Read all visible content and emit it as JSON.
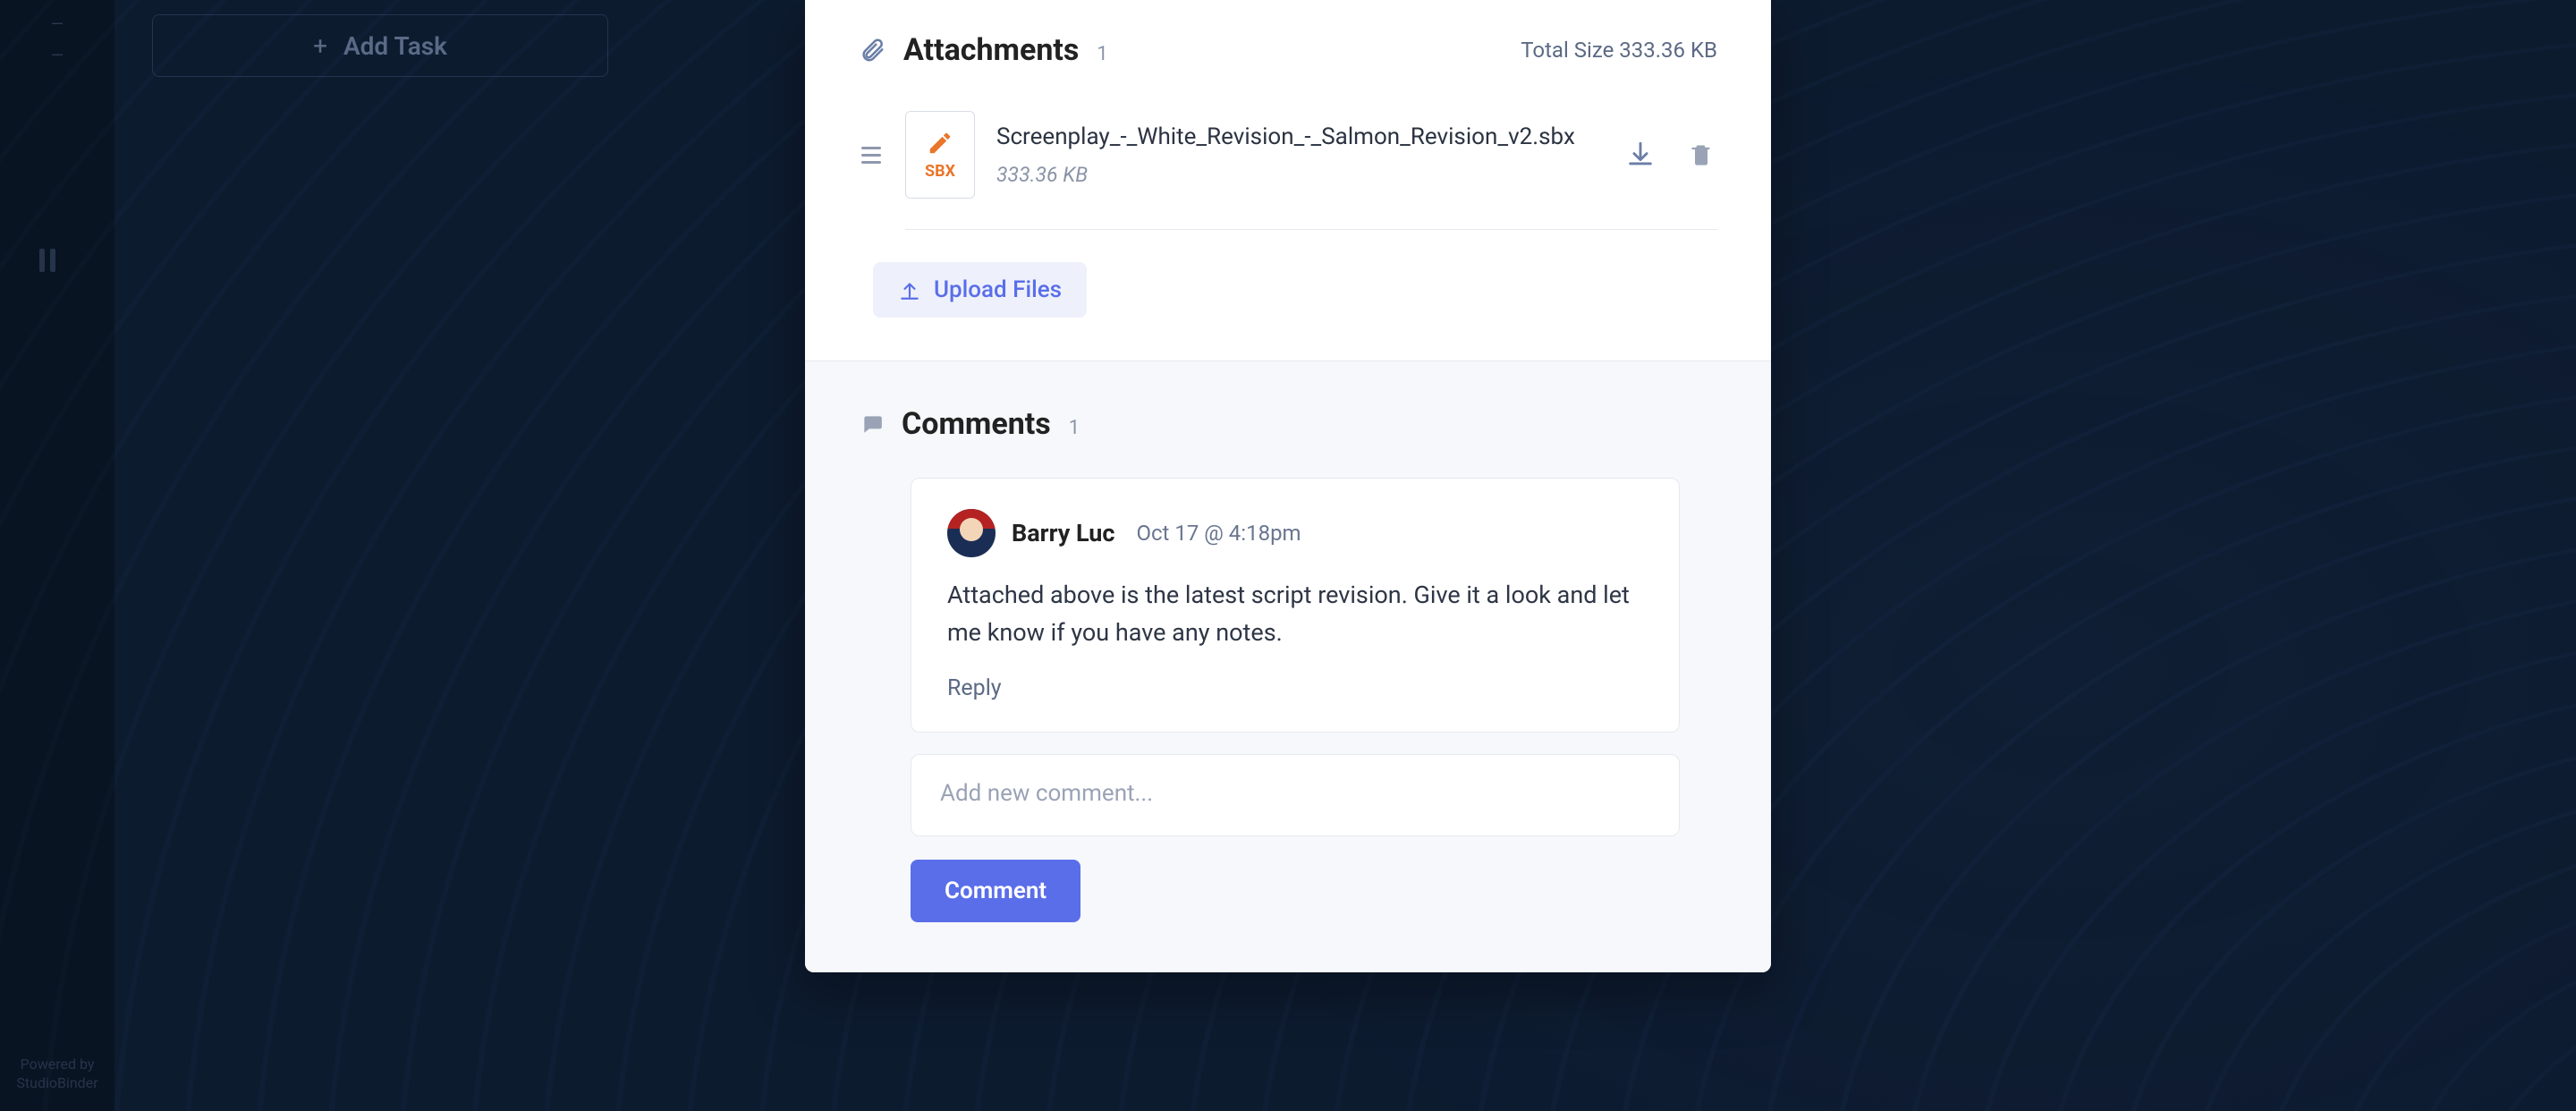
{
  "sidebar": {
    "primary_label_top": "—",
    "primary_label_bottom": "—"
  },
  "addTask": {
    "label": "Add Task"
  },
  "footer": {
    "powered_line1": "Powered by",
    "powered_line2": "StudioBinder"
  },
  "attachments": {
    "title": "Attachments",
    "count": "1",
    "total_label": "Total Size",
    "total_value": "333.36 KB",
    "items": [
      {
        "thumb_label": "SBX",
        "name": "Screenplay_-_White_Revision_-_Salmon_Revision_v2.sbx",
        "size": "333.36 KB"
      }
    ],
    "upload_label": "Upload Files"
  },
  "comments": {
    "title": "Comments",
    "count": "1",
    "items": [
      {
        "author": "Barry Luc",
        "timestamp": "Oct 17 @ 4:18pm",
        "body": "Attached above is the latest script revision. Give it a look and let me know if you have any notes.",
        "reply_label": "Reply"
      }
    ],
    "new_placeholder": "Add new comment...",
    "submit_label": "Comment"
  }
}
